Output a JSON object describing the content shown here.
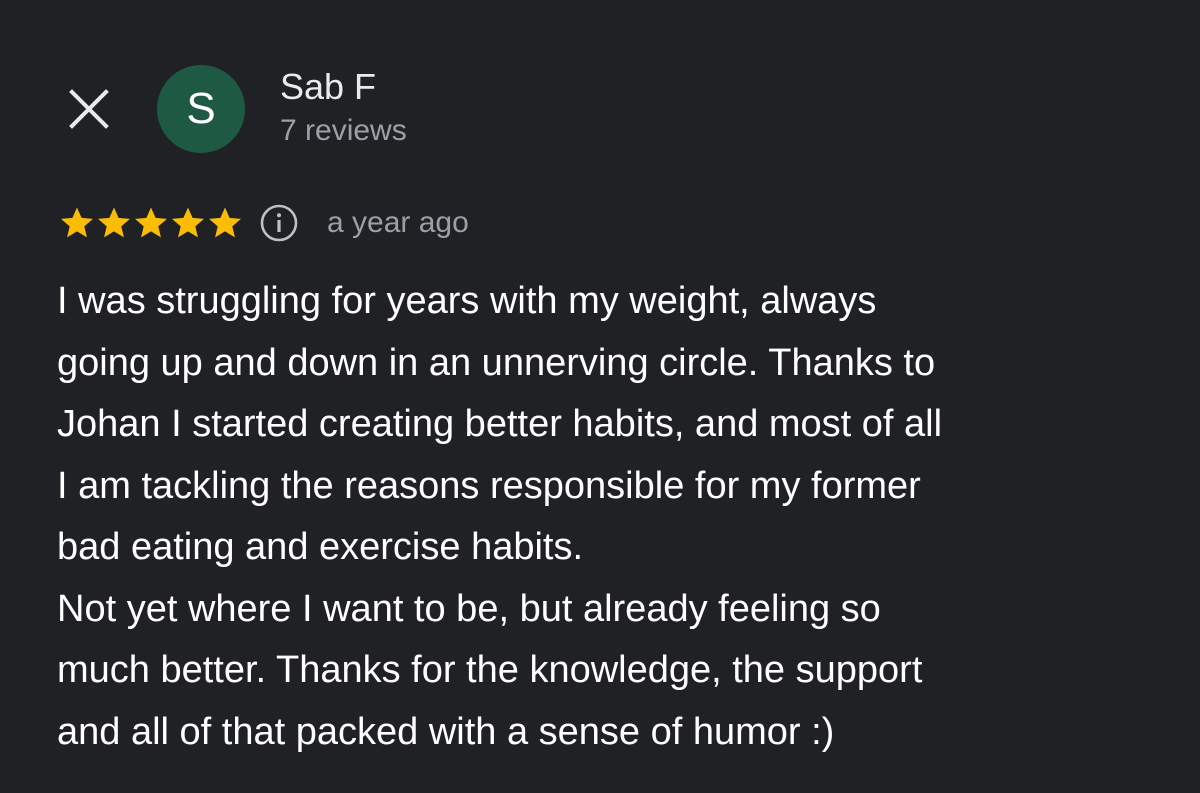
{
  "header": {
    "close_icon": "close-icon",
    "avatar_initial": "S",
    "avatar_color": "#1e5a43",
    "reviewer_name": "Sab F",
    "review_count": "7 reviews"
  },
  "rating": {
    "stars": 5,
    "max_stars": 5,
    "star_color": "#fbbc04",
    "info_icon": "info-icon",
    "date": "a year ago"
  },
  "review": {
    "lines": [
      "I was struggling for years with my weight, always",
      "going up and down in an unnerving circle. Thanks to",
      "Johan I started creating better habits, and most of all",
      "I am tackling the reasons responsible for my former",
      "bad eating and exercise habits.",
      "Not yet where I want to be, but already feeling so",
      "much better. Thanks for the knowledge, the support",
      "and all of that packed with a sense of humor :)"
    ]
  },
  "colors": {
    "background": "#202124",
    "primary_text": "#e8eaed",
    "secondary_text": "#9aa0a6"
  }
}
